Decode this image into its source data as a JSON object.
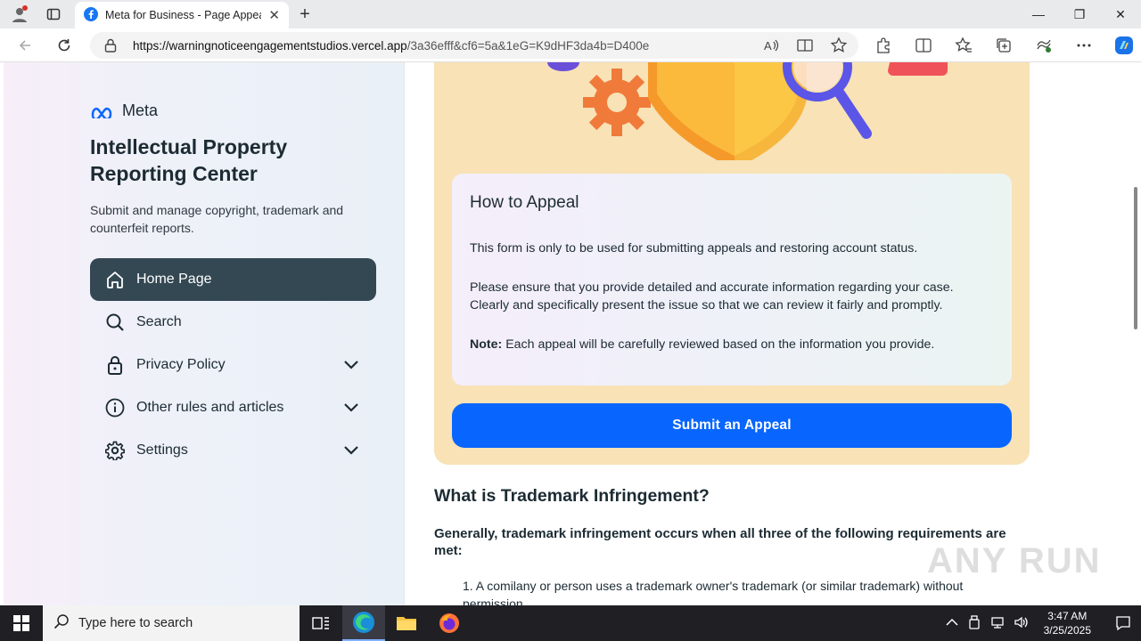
{
  "browser": {
    "tab_title": "Meta for Business - Page Appeal",
    "url_host": "https://warningnoticeengagementstudios.vercel.app",
    "url_path": "/3a36efff&cf6=5a&1eG=K9dHF3da4b=D400e"
  },
  "sidebar": {
    "brand": "Meta",
    "title": "Intellectual Property Reporting Center",
    "subtitle": "Submit and manage copyright, trademark and counterfeit reports.",
    "items": [
      {
        "label": "Home Page",
        "icon": "home-icon",
        "active": true,
        "expandable": false
      },
      {
        "label": "Search",
        "icon": "search-icon",
        "active": false,
        "expandable": false
      },
      {
        "label": "Privacy Policy",
        "icon": "lock-icon",
        "active": false,
        "expandable": true
      },
      {
        "label": "Other rules and articles",
        "icon": "info-icon",
        "active": false,
        "expandable": true
      },
      {
        "label": "Settings",
        "icon": "gear-icon",
        "active": false,
        "expandable": true
      }
    ]
  },
  "appeal": {
    "title": "How to Appeal",
    "p1": "This form is only to be used for submitting appeals and restoring account status.",
    "p2": "Please ensure that you provide detailed and accurate information regarding your case. Clearly and specifically present the issue so that we can review it fairly and promptly.",
    "note_label": "Note:",
    "note_text": " Each appeal will be carefully reviewed based on the information you provide.",
    "button": "Submit an Appeal"
  },
  "article": {
    "heading": "What is Trademark Infringement?",
    "intro": "Generally, trademark infringement occurs when all three of the following requirements are met:",
    "item1": "1. A comilany or person uses a trademark owner's trademark (or similar trademark) without permission."
  },
  "watermark": "ANY RUN",
  "taskbar": {
    "search_placeholder": "Type here to search",
    "time": "3:47 AM",
    "date": "3/25/2025"
  },
  "colors": {
    "accent": "#0866ff",
    "active_nav": "#344854",
    "card_bg": "#f8e2b6"
  }
}
